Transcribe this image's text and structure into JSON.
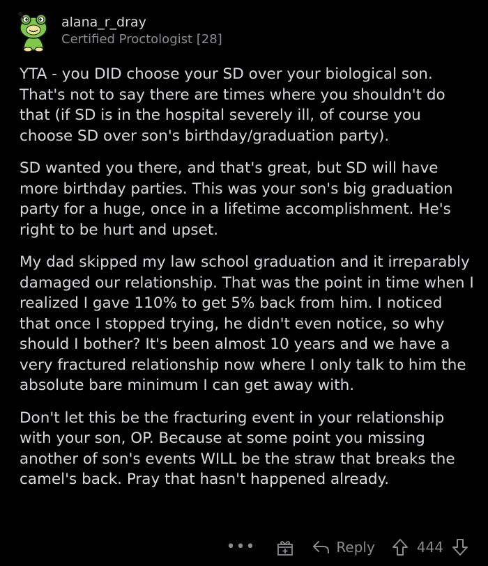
{
  "comment": {
    "author": "alana_r_dray",
    "flair": "Certified Proctologist [28]",
    "paragraphs": [
      "YTA - you DID choose your SD over your biological son. That's not to say there are times where you shouldn't do that (if SD is in the hospital severely ill, of course you choose SD over son's birthday/graduation party).",
      "SD wanted you there, and that's great, but SD will have more birthday parties. This was your son's big graduation party for a huge, once in a lifetime accomplishment. He's right to be hurt and upset.",
      "My dad skipped my law school graduation and it irreparably damaged our relationship. That was the point in time when I realized I gave 110% to get 5% back from him. I noticed that once I stopped trying, he didn't even notice, so why should I bother? It's been almost 10 years and we have a very fractured relationship now where I only talk to him the absolute bare minimum I can get away with.",
      "Don't let this be the fracturing event in your relationship with your son, OP. Because at some point you missing another of son's events WILL be the straw that breaks the camel's back. Pray that hasn't happened already."
    ]
  },
  "actions": {
    "more_label": "•••",
    "award_icon": "gift-icon",
    "reply_label": "Reply",
    "score": "444"
  },
  "colors": {
    "background": "#000000",
    "text": "#d7dadc",
    "muted": "#8a8d90",
    "avatar_green": "#7ec94a"
  }
}
